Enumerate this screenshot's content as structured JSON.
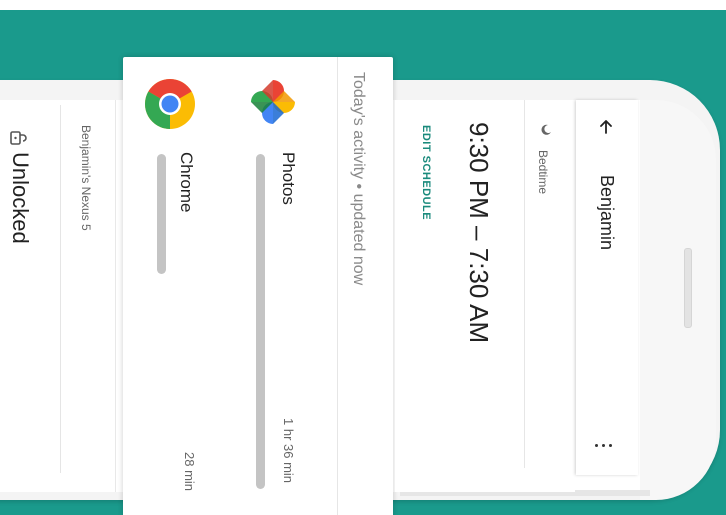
{
  "device": {
    "name": "Benjamin's Nexus 5",
    "lock_status": "Unlocked"
  },
  "activity": {
    "header": "Today's activity • updated now",
    "apps": [
      {
        "name": "Photos",
        "time": "1 hr 36 min",
        "icon": "google-photos-icon"
      },
      {
        "name": "Chrome",
        "time": "28 min",
        "icon": "chrome-icon"
      }
    ]
  },
  "schedule": {
    "label": "Bedtime",
    "range": "9:30 PM – 7:30 AM",
    "edit_label": "EDIT SCHEDULE"
  },
  "appbar": {
    "title": "Benjamin",
    "back_icon": "arrow-back-icon",
    "menu_icon": "more-vert-icon"
  },
  "colors": {
    "background": "#1a9a8c",
    "accent": "#1a8a7c"
  }
}
